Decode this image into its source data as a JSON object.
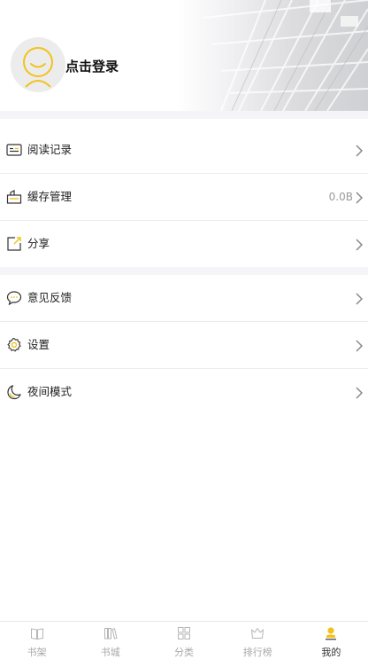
{
  "header": {
    "login_label": "点击登录"
  },
  "menu": [
    {
      "label": "阅读记录",
      "value": "",
      "icon": "reading-history-icon"
    },
    {
      "label": "缓存管理",
      "value": "0.0B",
      "icon": "cache-icon"
    },
    {
      "label": "分享",
      "value": "",
      "icon": "share-icon"
    },
    {
      "label": "意见反馈",
      "value": "",
      "icon": "feedback-icon"
    },
    {
      "label": "设置",
      "value": "",
      "icon": "gear-icon"
    },
    {
      "label": "夜间模式",
      "value": "",
      "icon": "moon-icon"
    }
  ],
  "tabs": [
    {
      "label": "书架",
      "icon": "bookshelf-icon",
      "active": false
    },
    {
      "label": "书城",
      "icon": "bookstore-icon",
      "active": false
    },
    {
      "label": "分类",
      "icon": "category-icon",
      "active": false
    },
    {
      "label": "排行榜",
      "icon": "ranking-icon",
      "active": false
    },
    {
      "label": "我的",
      "icon": "profile-icon",
      "active": true
    }
  ],
  "colors": {
    "accent": "#f2c21b",
    "background": "#ffffff",
    "separator": "#f5f5f7"
  }
}
